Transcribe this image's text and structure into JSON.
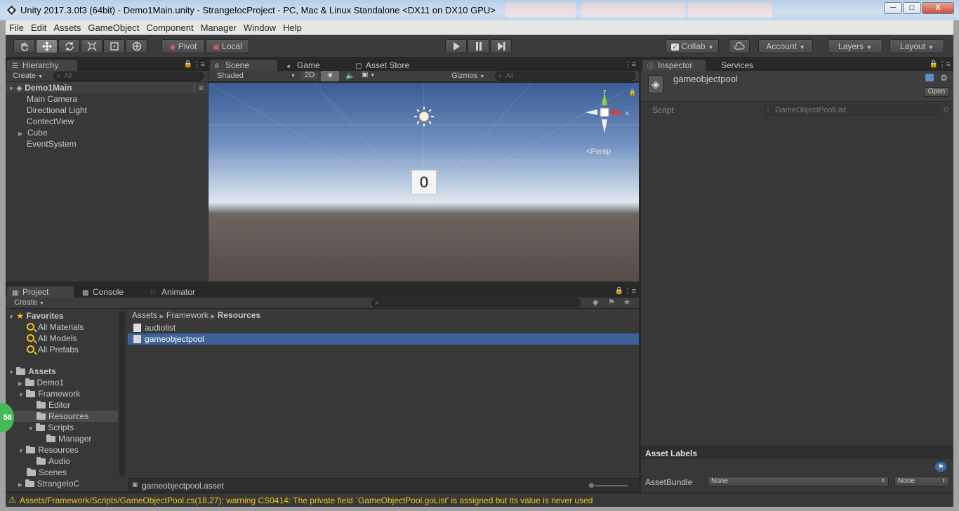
{
  "window": {
    "title": "Unity 2017.3.0f3 (64bit) - Demo1Main.unity - StrangeIocProject - PC, Mac & Linux Standalone <DX11 on DX10 GPU>",
    "min": "─",
    "max": "□",
    "close": "X"
  },
  "menu": [
    "File",
    "Edit",
    "Assets",
    "GameObject",
    "Component",
    "Manager",
    "Window",
    "Help"
  ],
  "toolbar": {
    "pivot": "Pivot",
    "local": "Local",
    "collab": "Collab",
    "account": "Account",
    "layers": "Layers",
    "layout": "Layout"
  },
  "hierarchy": {
    "tab": "Hierarchy",
    "create": "Create",
    "search_placeholder": "All",
    "scene": "Demo1Main",
    "items": [
      "Main Camera",
      "Directional Light",
      "ContectView",
      "Cube",
      "EventSystem"
    ]
  },
  "scene": {
    "tabs": [
      "Scene",
      "Game",
      "Asset Store"
    ],
    "shading": "Shaded",
    "mode2d": "2D",
    "gizmos": "Gizmos",
    "search_placeholder": "All",
    "counter": "0",
    "persp": "Persp",
    "axis_y": "y",
    "axis_x": "x"
  },
  "inspector": {
    "tabs": [
      "Inspector",
      "Services"
    ],
    "object_name": "gameobjectpool",
    "open": "Open",
    "script_label": "Script",
    "script_value": "GameObjectPoolList",
    "asset_labels": "Asset Labels",
    "assetbundle_label": "AssetBundle",
    "assetbundle_value": "None",
    "variant_value": "None"
  },
  "project": {
    "tabs": [
      "Project",
      "Console",
      "Animator"
    ],
    "create": "Create",
    "favorites_label": "Favorites",
    "favorites": [
      "All Materials",
      "All Models",
      "All Prefabs"
    ],
    "assets_label": "Assets",
    "folders": [
      "Demo1",
      "Framework",
      "Editor",
      "Resources",
      "Scripts",
      "Manager",
      "Resources",
      "Audio",
      "Scenes",
      "StrangeIoC"
    ],
    "breadcrumb": [
      "Assets",
      "Framework",
      "Resources"
    ],
    "files": [
      "audiolist",
      "gameobjectpool"
    ],
    "footer_file": "gameobjectpool.asset",
    "badge": "58"
  },
  "status": {
    "warning": "Assets/Framework/Scripts/GameObjectPool.cs(18,27): warning CS0414: The private field `GameObjectPool.goList' is assigned but its value is never used"
  }
}
